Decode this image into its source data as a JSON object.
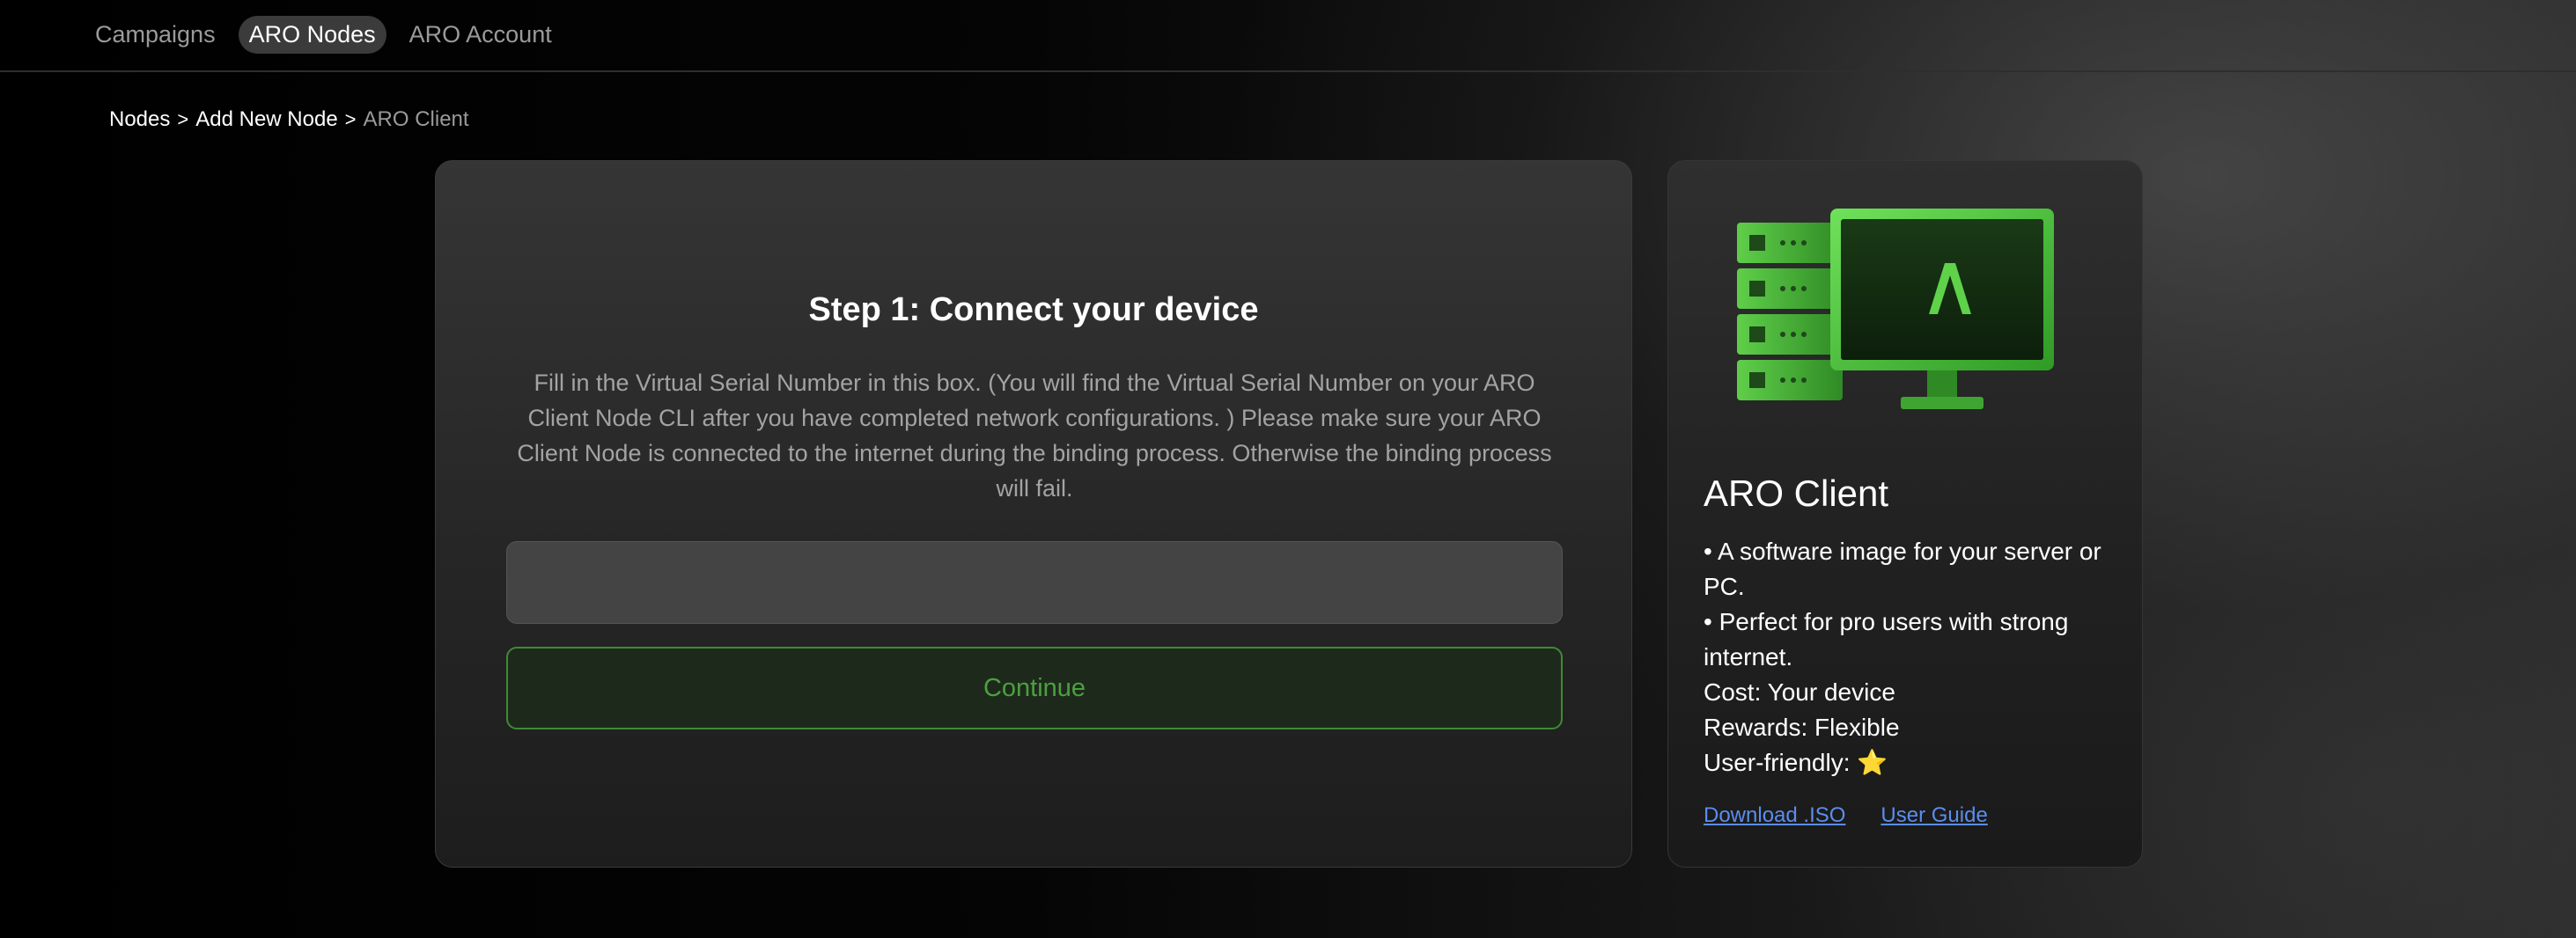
{
  "nav": {
    "items": [
      {
        "label": "Campaigns"
      },
      {
        "label": "ARO Nodes"
      },
      {
        "label": "ARO Account"
      }
    ],
    "active_index": 1
  },
  "breadcrumb": {
    "items": [
      "Nodes",
      "Add New Node",
      "ARO Client"
    ],
    "separator": ">"
  },
  "step": {
    "title": "Step 1: Connect your device",
    "description": "Fill in the Virtual Serial Number in this box. (You will find the Virtual Serial Number on your ARO Client Node CLI after you have completed network configurations. ) Please make sure your ARO Client Node is connected to the internet during the binding process. Otherwise the binding process will fail.",
    "input": {
      "value": "",
      "placeholder": ""
    },
    "continue_label": "Continue"
  },
  "client": {
    "illustration": "server-and-monitor-icon",
    "title": "ARO Client",
    "bullets": [
      "• A software image for your server or PC.",
      "• Perfect for pro users with strong internet."
    ],
    "cost": "Cost: Your device",
    "rewards": "Rewards: Flexible",
    "user_friendly": "User-friendly: ⭐",
    "links": {
      "download": "Download .ISO",
      "guide": "User Guide"
    }
  },
  "colors": {
    "accent_green": "#4d9f41",
    "link_blue": "#5b8def",
    "background": "#000000"
  }
}
